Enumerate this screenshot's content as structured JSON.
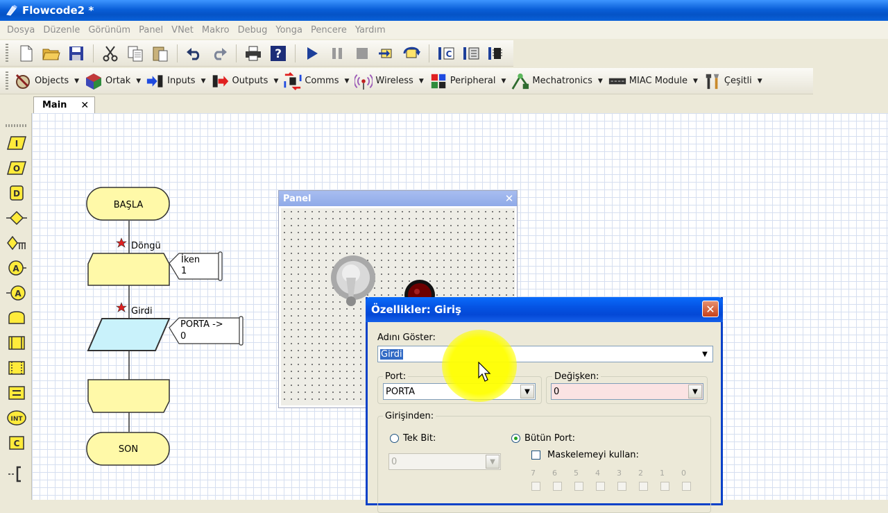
{
  "window": {
    "title": "Flowcode2 *"
  },
  "menu": [
    "Dosya",
    "Düzenle",
    "Görünüm",
    "Panel",
    "VNet",
    "Makro",
    "Debug",
    "Yonga",
    "Pencere",
    "Yardım"
  ],
  "toolbar": {
    "icons": [
      "new-file-icon",
      "open-folder-icon",
      "save-icon",
      "cut-icon",
      "copy-icon",
      "paste-icon",
      "undo-icon",
      "redo-icon",
      "print-icon",
      "help-icon",
      "run-icon",
      "pause-icon",
      "stop-icon",
      "step-into-icon",
      "step-over-icon",
      "compile-to-c-icon",
      "compile-to-hex-icon",
      "compile-to-chip-icon"
    ]
  },
  "components": [
    {
      "label": "Objects",
      "icon": "objects-icon"
    },
    {
      "label": "Ortak",
      "icon": "ortak-icon"
    },
    {
      "label": "Inputs",
      "icon": "inputs-icon"
    },
    {
      "label": "Outputs",
      "icon": "outputs-icon"
    },
    {
      "label": "Comms",
      "icon": "comms-icon"
    },
    {
      "label": "Wireless",
      "icon": "wireless-icon"
    },
    {
      "label": "Peripheral",
      "icon": "peripheral-icon"
    },
    {
      "label": "Mechatronics",
      "icon": "mechatronics-icon"
    },
    {
      "label": "MIAC Module",
      "icon": "miac-icon"
    },
    {
      "label": "Çeşitli",
      "icon": "tools-icon"
    }
  ],
  "tab": {
    "label": "Main",
    "close": "✕"
  },
  "palette": [
    {
      "glyph": "I",
      "name": "input-icon"
    },
    {
      "glyph": "O",
      "name": "output-icon"
    },
    {
      "glyph": "D",
      "name": "delay-icon"
    },
    {
      "glyph": "",
      "name": "decision-icon"
    },
    {
      "glyph": "",
      "name": "switch-icon"
    },
    {
      "glyph": "A",
      "name": "analog-input-icon"
    },
    {
      "glyph": "A",
      "name": "analog-output-icon"
    },
    {
      "glyph": "",
      "name": "loop-icon"
    },
    {
      "glyph": "",
      "name": "macro-icon"
    },
    {
      "glyph": "",
      "name": "component-macro-icon"
    },
    {
      "glyph": "",
      "name": "calculation-icon"
    },
    {
      "glyph": "INT",
      "name": "interrupt-icon"
    },
    {
      "glyph": "C",
      "name": "c-code-icon"
    },
    {
      "glyph": "",
      "name": "comment-icon"
    }
  ],
  "flowchart": {
    "start": "BAŞLA",
    "end": "SON",
    "loop_label": "Döngü",
    "loop_note_line1": "İken",
    "loop_note_line2": "1",
    "input_label": "Girdi",
    "input_note_line1": "PORTA ->",
    "input_note_line2": "0"
  },
  "panel": {
    "title": "Panel",
    "close": "✕"
  },
  "dialog": {
    "title": "Özellikler: Giriş",
    "close": "✕",
    "name_label": "Adını Göster:",
    "name_value": "Girdi",
    "port_label": "Port:",
    "port_value": "PORTA",
    "variable_label": "Değişken:",
    "variable_value": "0",
    "input_group_label": "Girişinden:",
    "single_bit_label": "Tek Bit:",
    "single_bit_value": "0",
    "whole_port_label": "Bütün Port:",
    "mask_label": "Maskelemeyi kullan:",
    "bits": [
      "7",
      "6",
      "5",
      "4",
      "3",
      "2",
      "1",
      "0"
    ]
  }
}
